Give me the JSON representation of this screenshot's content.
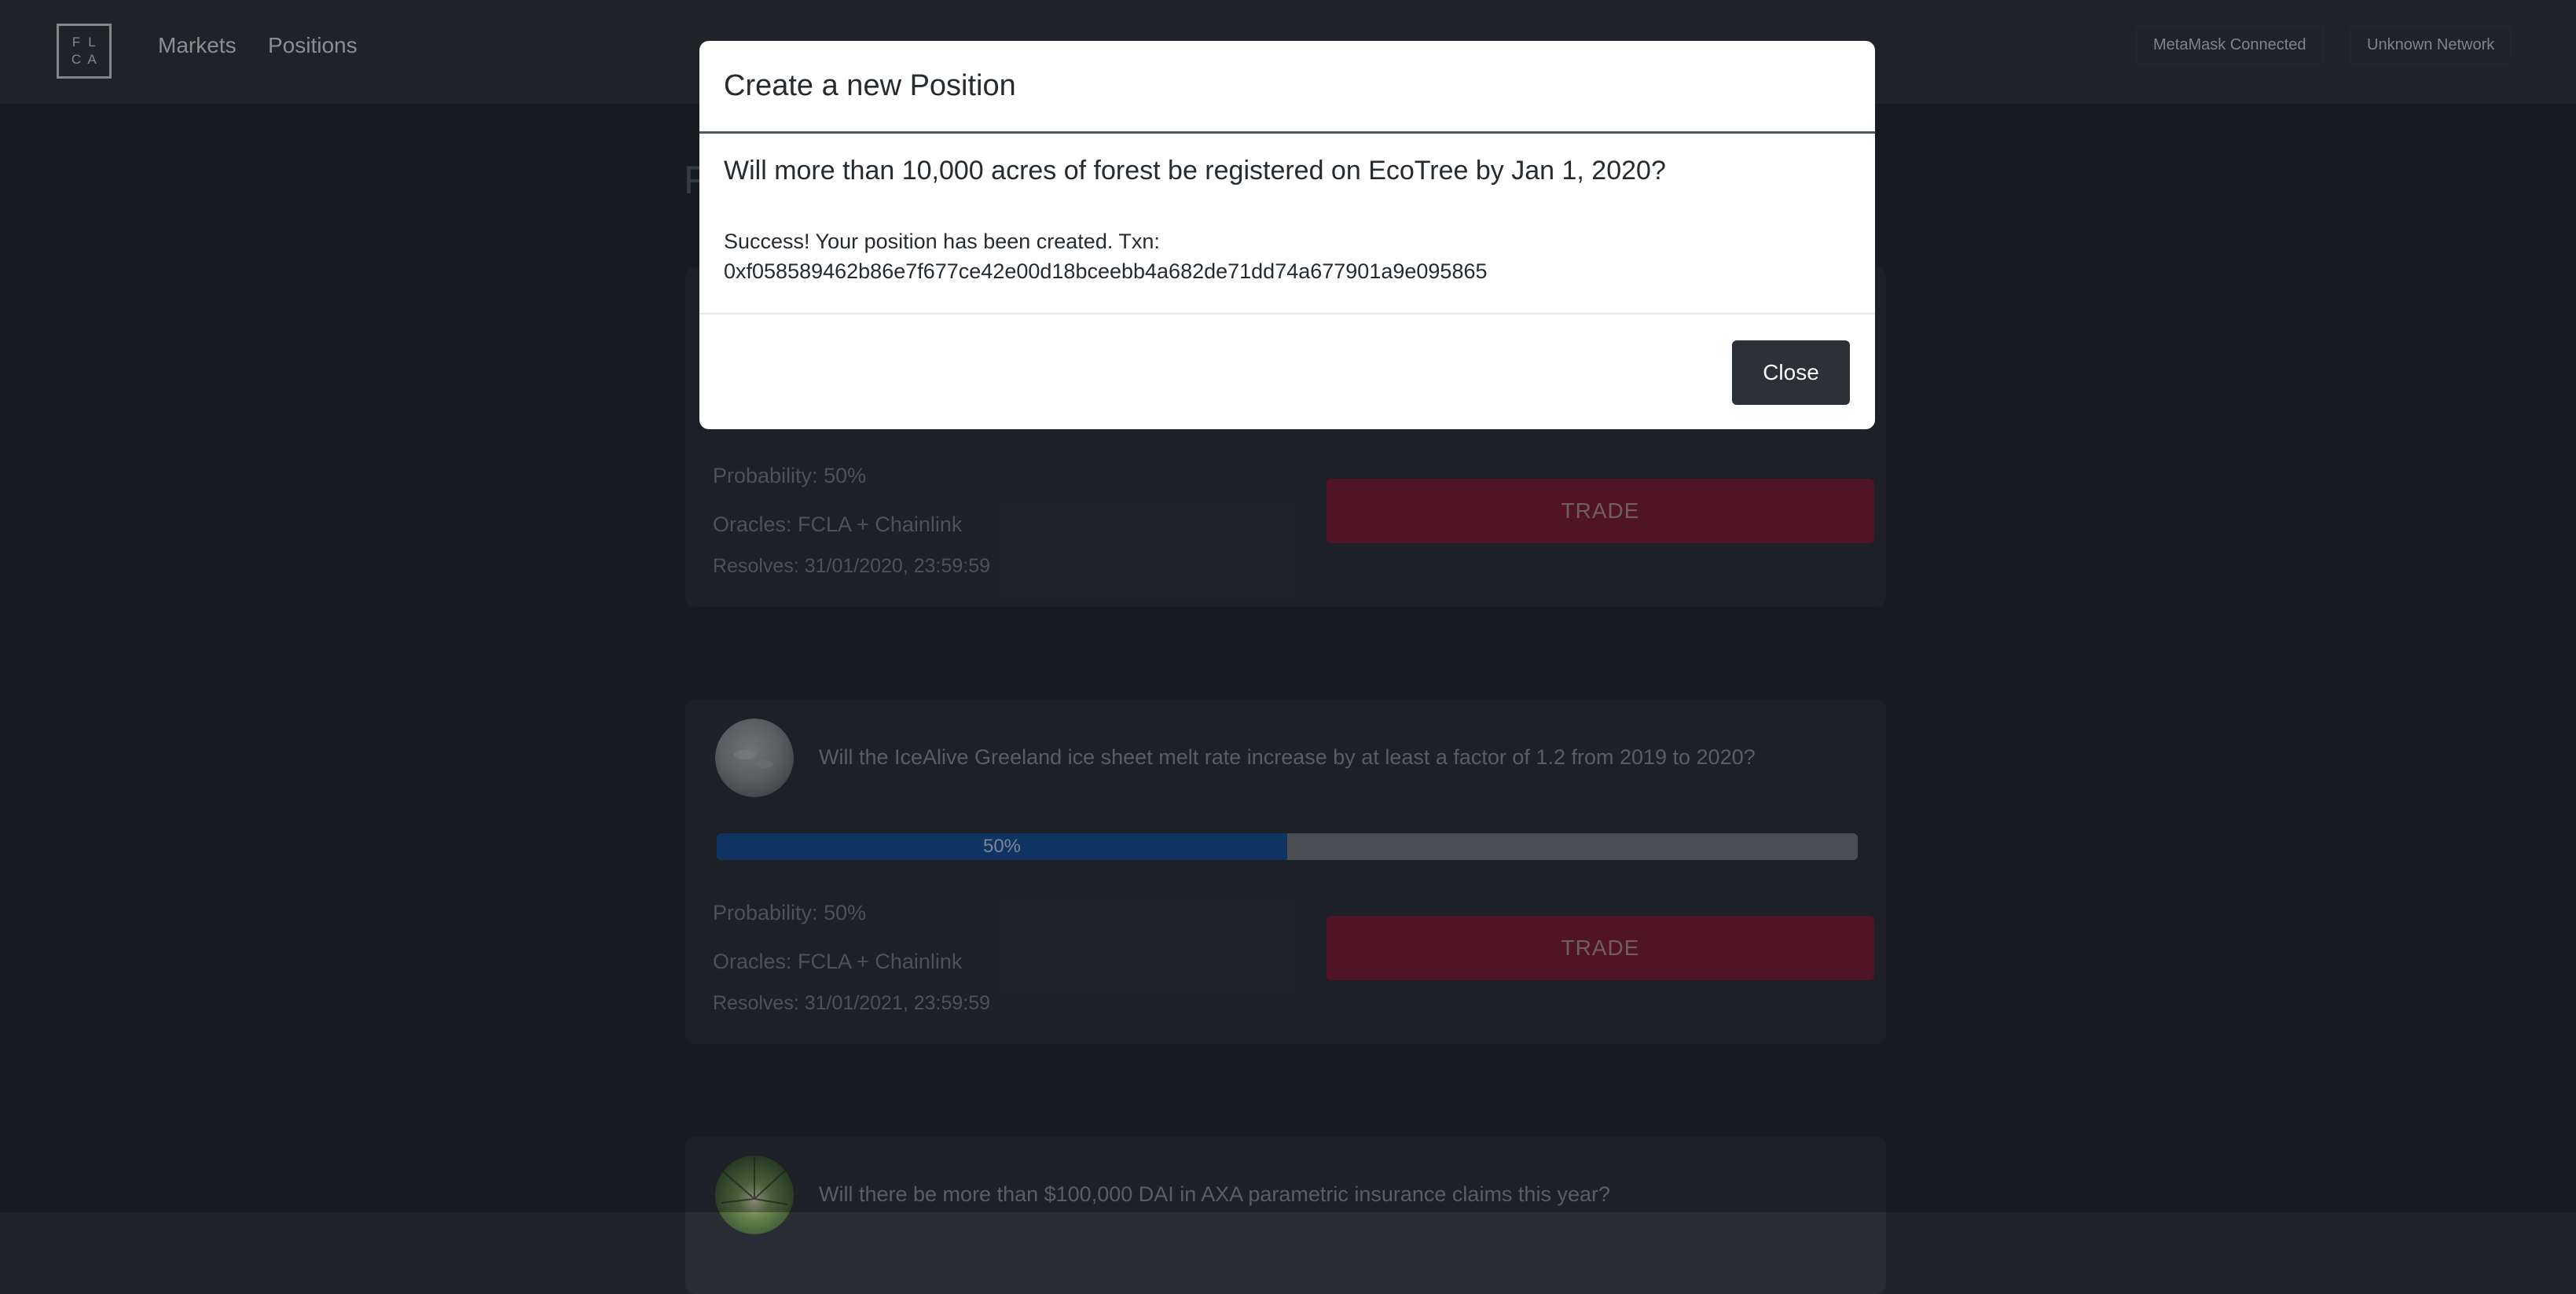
{
  "nav": {
    "logo_letters": [
      "F",
      "L",
      "C",
      "A"
    ],
    "links": [
      "Markets",
      "Positions"
    ],
    "wallet_status": "MetaMask Connected",
    "network_status": "Unknown Network"
  },
  "page": {
    "heading_initial": "F"
  },
  "cards": [
    {
      "question": "",
      "probability": "Probability: 50%",
      "oracles": "Oracles: FCLA + Chainlink",
      "resolves": "Resolves: 31/01/2020, 23:59:59",
      "trade_label": "TRADE"
    },
    {
      "question": "Will the IceAlive Greeland ice sheet melt rate increase by at least a factor of 1.2 from 2019 to 2020?",
      "progress_label": "50%",
      "progress_fraction": 0.5,
      "probability": "Probability: 50%",
      "oracles": "Oracles: FCLA + Chainlink",
      "resolves": "Resolves: 31/01/2021, 23:59:59",
      "trade_label": "TRADE"
    },
    {
      "question": "Will there be more than $100,000 DAI in AXA parametric insurance claims this year?"
    }
  ],
  "modal": {
    "title": "Create a new Position",
    "question": "Will more than 10,000 acres of forest be registered on EcoTree by Jan 1, 2020?",
    "success_line1": "Success! Your position has been created. Txn:",
    "success_line2": "0xf058589462b86e7f677ce42e00d18bceebb4a682de71dd74a677901a9e095865",
    "close_label": "Close"
  },
  "colors": {
    "background": "#21252b",
    "navbar": "#2c3036",
    "card": "#282c33",
    "trade_button": "#781a33",
    "progress_fill": "#154a8e",
    "modal_button": "#2b3138"
  }
}
